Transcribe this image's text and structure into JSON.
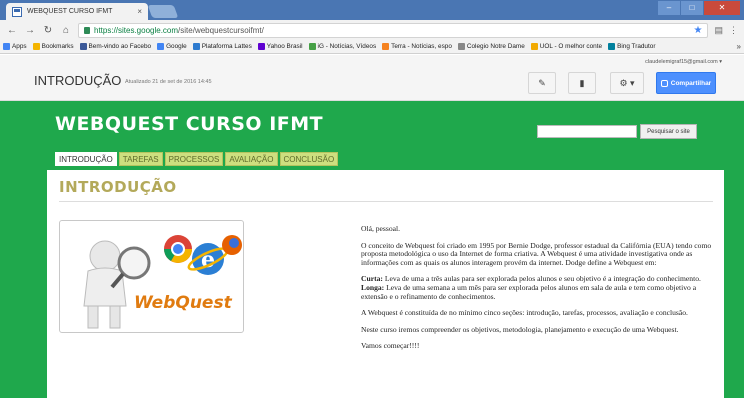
{
  "browser": {
    "tab_title": "WEBQUEST CURSO IFMT",
    "tab_close": "×",
    "url_host": "https://sites.google.com",
    "url_path": "/site/webquestcursoifmt/",
    "bookmarks": [
      {
        "label": "Apps",
        "color": "#4285f4"
      },
      {
        "label": "Bookmarks",
        "color": "#f4b400"
      },
      {
        "label": "Bem-vindo ao Facebo",
        "color": "#3b5998"
      },
      {
        "label": "Google",
        "color": "#4285f4"
      },
      {
        "label": "Plataforma Lattes",
        "color": "#2e7bcf"
      },
      {
        "label": "Yahoo Brasil",
        "color": "#5f01d1"
      },
      {
        "label": "iG - Notícias, Vídeos",
        "color": "#46a046"
      },
      {
        "label": "Terra - Notícias, espo",
        "color": "#f58220"
      },
      {
        "label": "Colegio Notre Dame",
        "color": "#888888"
      },
      {
        "label": "UOL - O melhor conte",
        "color": "#f2a900"
      },
      {
        "label": "Bing Tradutor",
        "color": "#00809d"
      }
    ],
    "bookmarks_more": "»"
  },
  "sites_bar": {
    "page_heading": "INTRODUÇÃO",
    "updated": "Atualizado 21 de set de 2016 14:45",
    "email": "claudelemigraf15@gmail.com ▾",
    "share_label": "Compartilhar"
  },
  "site": {
    "title": "WEBQUEST CURSO IFMT",
    "search_button": "Pesquisar o site",
    "nav_tabs": [
      {
        "label": "INTRODUÇÃO",
        "active": true
      },
      {
        "label": "TAREFAS",
        "active": false
      },
      {
        "label": "PROCESSOS",
        "active": false
      },
      {
        "label": "AVALIAÇÃO",
        "active": false
      },
      {
        "label": "CONCLUSÃO",
        "active": false
      }
    ],
    "section_title": "INTRODUÇÃO",
    "image_label": "WebQuest",
    "greeting": "Olá, pessoal.",
    "para1": "O conceito de Webquest foi criado em 1995 por Bernie Dodge, professor estadual da Califórnia (EUA) tendo como proposta metodológica o uso da Internet de forma criativa. A Webquest é uma atividade investigativa onde as informações com as quais os alunos interagem provém da internet. Dodge define a Webquest em:",
    "curta_label": "Curta:",
    "curta_text": " Leva de uma a três aulas para ser explorada pelos alunos e seu objetivo é a integração do conhecimento.",
    "longa_label": "Longa:",
    "longa_text": " Leva de uma semana a um mês para ser explorada pelos alunos em sala de aula e tem como objetivo a extensão e o refinamento de conhecimentos.",
    "para3": "A Webquest é constituída de no mínimo cinco seções: introdução, tarefas, processos, avaliação e conclusão.",
    "para4": "Neste curso iremos compreender os objetivos, metodologia, planejamento e execução de uma Webquest.",
    "closing": "Vamos começar!!!!"
  }
}
